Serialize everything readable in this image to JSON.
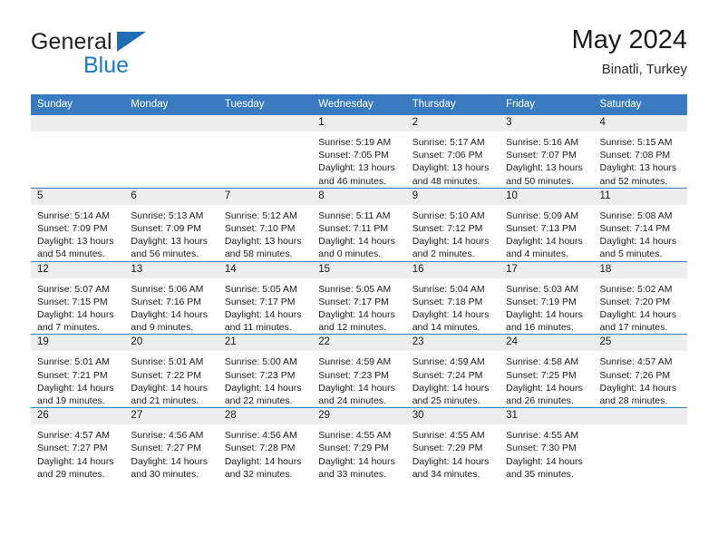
{
  "brand": {
    "name_part1": "General",
    "name_part2": "Blue",
    "triangle_color": "#1f6cb4",
    "blue_color": "#1f7ac4"
  },
  "header": {
    "title": "May 2024",
    "subtitle": "Binatli, Turkey",
    "header_bg_color": "#3a7ac0",
    "daynum_bg_color": "#ededed"
  },
  "weekdays": [
    "Sunday",
    "Monday",
    "Tuesday",
    "Wednesday",
    "Thursday",
    "Friday",
    "Saturday"
  ],
  "weeks": [
    [
      {
        "day": "",
        "empty": true,
        "sunrise": "",
        "sunset": "",
        "daylight1": "",
        "daylight2": ""
      },
      {
        "day": "",
        "empty": true,
        "sunrise": "",
        "sunset": "",
        "daylight1": "",
        "daylight2": ""
      },
      {
        "day": "",
        "empty": true,
        "sunrise": "",
        "sunset": "",
        "daylight1": "",
        "daylight2": ""
      },
      {
        "day": "1",
        "empty": false,
        "sunrise": "Sunrise: 5:19 AM",
        "sunset": "Sunset: 7:05 PM",
        "daylight1": "Daylight: 13 hours",
        "daylight2": "and 46 minutes."
      },
      {
        "day": "2",
        "empty": false,
        "sunrise": "Sunrise: 5:17 AM",
        "sunset": "Sunset: 7:06 PM",
        "daylight1": "Daylight: 13 hours",
        "daylight2": "and 48 minutes."
      },
      {
        "day": "3",
        "empty": false,
        "sunrise": "Sunrise: 5:16 AM",
        "sunset": "Sunset: 7:07 PM",
        "daylight1": "Daylight: 13 hours",
        "daylight2": "and 50 minutes."
      },
      {
        "day": "4",
        "empty": false,
        "sunrise": "Sunrise: 5:15 AM",
        "sunset": "Sunset: 7:08 PM",
        "daylight1": "Daylight: 13 hours",
        "daylight2": "and 52 minutes."
      }
    ],
    [
      {
        "day": "5",
        "empty": false,
        "sunrise": "Sunrise: 5:14 AM",
        "sunset": "Sunset: 7:09 PM",
        "daylight1": "Daylight: 13 hours",
        "daylight2": "and 54 minutes."
      },
      {
        "day": "6",
        "empty": false,
        "sunrise": "Sunrise: 5:13 AM",
        "sunset": "Sunset: 7:09 PM",
        "daylight1": "Daylight: 13 hours",
        "daylight2": "and 56 minutes."
      },
      {
        "day": "7",
        "empty": false,
        "sunrise": "Sunrise: 5:12 AM",
        "sunset": "Sunset: 7:10 PM",
        "daylight1": "Daylight: 13 hours",
        "daylight2": "and 58 minutes."
      },
      {
        "day": "8",
        "empty": false,
        "sunrise": "Sunrise: 5:11 AM",
        "sunset": "Sunset: 7:11 PM",
        "daylight1": "Daylight: 14 hours",
        "daylight2": "and 0 minutes."
      },
      {
        "day": "9",
        "empty": false,
        "sunrise": "Sunrise: 5:10 AM",
        "sunset": "Sunset: 7:12 PM",
        "daylight1": "Daylight: 14 hours",
        "daylight2": "and 2 minutes."
      },
      {
        "day": "10",
        "empty": false,
        "sunrise": "Sunrise: 5:09 AM",
        "sunset": "Sunset: 7:13 PM",
        "daylight1": "Daylight: 14 hours",
        "daylight2": "and 4 minutes."
      },
      {
        "day": "11",
        "empty": false,
        "sunrise": "Sunrise: 5:08 AM",
        "sunset": "Sunset: 7:14 PM",
        "daylight1": "Daylight: 14 hours",
        "daylight2": "and 5 minutes."
      }
    ],
    [
      {
        "day": "12",
        "empty": false,
        "sunrise": "Sunrise: 5:07 AM",
        "sunset": "Sunset: 7:15 PM",
        "daylight1": "Daylight: 14 hours",
        "daylight2": "and 7 minutes."
      },
      {
        "day": "13",
        "empty": false,
        "sunrise": "Sunrise: 5:06 AM",
        "sunset": "Sunset: 7:16 PM",
        "daylight1": "Daylight: 14 hours",
        "daylight2": "and 9 minutes."
      },
      {
        "day": "14",
        "empty": false,
        "sunrise": "Sunrise: 5:05 AM",
        "sunset": "Sunset: 7:17 PM",
        "daylight1": "Daylight: 14 hours",
        "daylight2": "and 11 minutes."
      },
      {
        "day": "15",
        "empty": false,
        "sunrise": "Sunrise: 5:05 AM",
        "sunset": "Sunset: 7:17 PM",
        "daylight1": "Daylight: 14 hours",
        "daylight2": "and 12 minutes."
      },
      {
        "day": "16",
        "empty": false,
        "sunrise": "Sunrise: 5:04 AM",
        "sunset": "Sunset: 7:18 PM",
        "daylight1": "Daylight: 14 hours",
        "daylight2": "and 14 minutes."
      },
      {
        "day": "17",
        "empty": false,
        "sunrise": "Sunrise: 5:03 AM",
        "sunset": "Sunset: 7:19 PM",
        "daylight1": "Daylight: 14 hours",
        "daylight2": "and 16 minutes."
      },
      {
        "day": "18",
        "empty": false,
        "sunrise": "Sunrise: 5:02 AM",
        "sunset": "Sunset: 7:20 PM",
        "daylight1": "Daylight: 14 hours",
        "daylight2": "and 17 minutes."
      }
    ],
    [
      {
        "day": "19",
        "empty": false,
        "sunrise": "Sunrise: 5:01 AM",
        "sunset": "Sunset: 7:21 PM",
        "daylight1": "Daylight: 14 hours",
        "daylight2": "and 19 minutes."
      },
      {
        "day": "20",
        "empty": false,
        "sunrise": "Sunrise: 5:01 AM",
        "sunset": "Sunset: 7:22 PM",
        "daylight1": "Daylight: 14 hours",
        "daylight2": "and 21 minutes."
      },
      {
        "day": "21",
        "empty": false,
        "sunrise": "Sunrise: 5:00 AM",
        "sunset": "Sunset: 7:23 PM",
        "daylight1": "Daylight: 14 hours",
        "daylight2": "and 22 minutes."
      },
      {
        "day": "22",
        "empty": false,
        "sunrise": "Sunrise: 4:59 AM",
        "sunset": "Sunset: 7:23 PM",
        "daylight1": "Daylight: 14 hours",
        "daylight2": "and 24 minutes."
      },
      {
        "day": "23",
        "empty": false,
        "sunrise": "Sunrise: 4:59 AM",
        "sunset": "Sunset: 7:24 PM",
        "daylight1": "Daylight: 14 hours",
        "daylight2": "and 25 minutes."
      },
      {
        "day": "24",
        "empty": false,
        "sunrise": "Sunrise: 4:58 AM",
        "sunset": "Sunset: 7:25 PM",
        "daylight1": "Daylight: 14 hours",
        "daylight2": "and 26 minutes."
      },
      {
        "day": "25",
        "empty": false,
        "sunrise": "Sunrise: 4:57 AM",
        "sunset": "Sunset: 7:26 PM",
        "daylight1": "Daylight: 14 hours",
        "daylight2": "and 28 minutes."
      }
    ],
    [
      {
        "day": "26",
        "empty": false,
        "sunrise": "Sunrise: 4:57 AM",
        "sunset": "Sunset: 7:27 PM",
        "daylight1": "Daylight: 14 hours",
        "daylight2": "and 29 minutes."
      },
      {
        "day": "27",
        "empty": false,
        "sunrise": "Sunrise: 4:56 AM",
        "sunset": "Sunset: 7:27 PM",
        "daylight1": "Daylight: 14 hours",
        "daylight2": "and 30 minutes."
      },
      {
        "day": "28",
        "empty": false,
        "sunrise": "Sunrise: 4:56 AM",
        "sunset": "Sunset: 7:28 PM",
        "daylight1": "Daylight: 14 hours",
        "daylight2": "and 32 minutes."
      },
      {
        "day": "29",
        "empty": false,
        "sunrise": "Sunrise: 4:55 AM",
        "sunset": "Sunset: 7:29 PM",
        "daylight1": "Daylight: 14 hours",
        "daylight2": "and 33 minutes."
      },
      {
        "day": "30",
        "empty": false,
        "sunrise": "Sunrise: 4:55 AM",
        "sunset": "Sunset: 7:29 PM",
        "daylight1": "Daylight: 14 hours",
        "daylight2": "and 34 minutes."
      },
      {
        "day": "31",
        "empty": false,
        "sunrise": "Sunrise: 4:55 AM",
        "sunset": "Sunset: 7:30 PM",
        "daylight1": "Daylight: 14 hours",
        "daylight2": "and 35 minutes."
      },
      {
        "day": "",
        "empty": true,
        "sunrise": "",
        "sunset": "",
        "daylight1": "",
        "daylight2": ""
      }
    ]
  ]
}
